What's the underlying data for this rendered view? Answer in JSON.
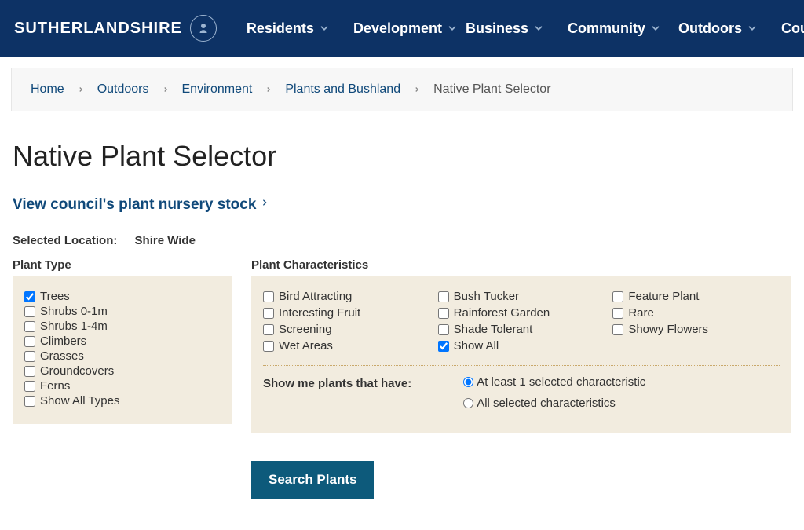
{
  "brand": "SUTHERLANDSHIRE",
  "nav": [
    "Residents",
    "Development",
    "Business",
    "Community",
    "Outdoors",
    "Council"
  ],
  "breadcrumb": {
    "items": [
      "Home",
      "Outdoors",
      "Environment",
      "Plants and Bushland"
    ],
    "current": "Native Plant Selector"
  },
  "page_title": "Native Plant Selector",
  "sublink": "View council's plant nursery stock",
  "location": {
    "label": "Selected Location:",
    "value": "Shire Wide"
  },
  "plant_type": {
    "title": "Plant Type",
    "items": [
      {
        "label": "Trees",
        "checked": true
      },
      {
        "label": "Shrubs 0-1m",
        "checked": false
      },
      {
        "label": "Shrubs 1-4m",
        "checked": false
      },
      {
        "label": "Climbers",
        "checked": false
      },
      {
        "label": "Grasses",
        "checked": false
      },
      {
        "label": "Groundcovers",
        "checked": false
      },
      {
        "label": "Ferns",
        "checked": false
      },
      {
        "label": "Show All Types",
        "checked": false
      }
    ]
  },
  "characteristics": {
    "title": "Plant Characteristics",
    "items": [
      {
        "label": "Bird Attracting",
        "checked": false
      },
      {
        "label": "Bush Tucker",
        "checked": false
      },
      {
        "label": "Feature Plant",
        "checked": false
      },
      {
        "label": "Interesting Fruit",
        "checked": false
      },
      {
        "label": "Rainforest Garden",
        "checked": false
      },
      {
        "label": "Rare",
        "checked": false
      },
      {
        "label": "Screening",
        "checked": false
      },
      {
        "label": "Shade Tolerant",
        "checked": false
      },
      {
        "label": "Showy Flowers",
        "checked": false
      },
      {
        "label": "Wet Areas",
        "checked": false
      },
      {
        "label": "Show All",
        "checked": true
      }
    ]
  },
  "match": {
    "label": "Show me plants that have:",
    "options": [
      {
        "label": "At least 1 selected characteristic",
        "checked": true
      },
      {
        "label": "All selected characteristics",
        "checked": false
      }
    ]
  },
  "search_button": "Search Plants"
}
